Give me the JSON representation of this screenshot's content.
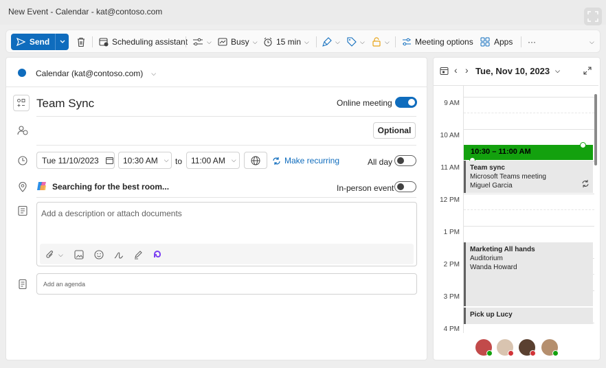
{
  "window": {
    "title": "New Event - Calendar - kat@contoso.com"
  },
  "toolbar": {
    "send_label": "Send",
    "scheduling_label": "Scheduling assistant",
    "busy_label": "Busy",
    "reminder_label": "15 min",
    "meeting_options_label": "Meeting options",
    "apps_label": "Apps",
    "more_label": "···"
  },
  "form": {
    "calendar_label": "Calendar (kat@contoso.com)",
    "subject": "Team Sync",
    "online_meeting_label": "Online meeting",
    "optional_label": "Optional",
    "start_date": "Tue 11/10/2023",
    "start_time": "10:30 AM",
    "to_label": "to",
    "end_time": "11:00 AM",
    "make_recurring_label": "Make recurring",
    "all_day_label": "All day",
    "location_text": "Searching for the best room...",
    "in_person_label": "In-person event",
    "description_placeholder": "Add a description or attach documents",
    "agenda_placeholder": "Add an agenda"
  },
  "calendar": {
    "date_label": "Tue, Nov 10, 2023",
    "time_labels": [
      "9 AM",
      "10 AM",
      "11 AM",
      "12 PM",
      "1 PM",
      "2 PM",
      "3 PM",
      "4 PM"
    ],
    "current_event": {
      "time": "10:30 – 11:00 AM"
    },
    "events": [
      {
        "title": "Team sync",
        "line2": "Microsoft Teams meeting",
        "line3": "Miguel Garcia"
      },
      {
        "title": "Marketing All hands",
        "line2": "Auditorium",
        "line3": "Wanda Howard"
      },
      {
        "title": "Pick up Lucy",
        "line2": "",
        "line3": ""
      }
    ]
  },
  "colors": {
    "accent": "#0f6cbd",
    "event_green": "#13a10e",
    "event_gray": "#e8e8e8"
  }
}
